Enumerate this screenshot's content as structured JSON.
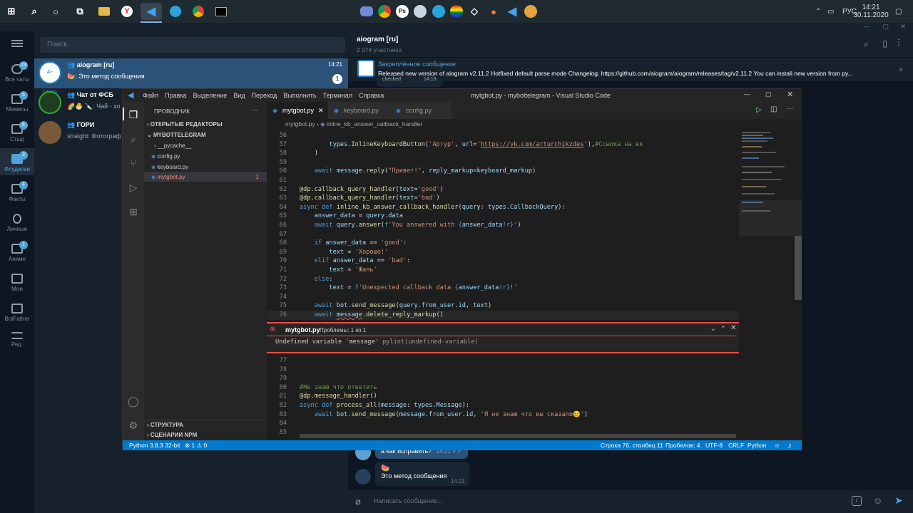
{
  "taskbar": {
    "lang": "РУС",
    "time": "14:21",
    "date": "30.11.2020"
  },
  "folders": [
    {
      "label": "Все чаты",
      "badge": "23"
    },
    {
      "label": "Мемесы",
      "badge": "5"
    },
    {
      "label": "Стыд",
      "badge": "6"
    },
    {
      "label": "Флудилки",
      "badge": "3"
    },
    {
      "label": "Факты",
      "badge": "4"
    },
    {
      "label": "Личные",
      "badge": ""
    },
    {
      "label": "Аниме",
      "badge": "1"
    },
    {
      "label": "Мои",
      "badge": ""
    },
    {
      "label": "BotFather",
      "badge": ""
    },
    {
      "label": "Ред.",
      "badge": ""
    }
  ],
  "chatlist": {
    "search_placeholder": "Поиск",
    "chats": [
      {
        "name": "aiogram [ru]",
        "preview": "🍉: Это метод сообщения",
        "time": "14:21",
        "unread": "1"
      },
      {
        "name": "Чат от ФСБ",
        "preview": "🌈🐣 🔪: Чай - хо",
        "time": "",
        "unread": ""
      },
      {
        "name": "ГОРИ",
        "preview": "straight: Фотограф",
        "time": "",
        "unread": ""
      }
    ]
  },
  "chat": {
    "title": "aiogram [ru]",
    "members": "2 074 участника",
    "pinned_label": "Закреплённое сообщение",
    "pinned_text": "Released new version of aiogram v2.11.2  Hotfixed default parse mode  Changelog: https://github.com/aiogram/aiogram/releases/tag/v2.11.2 You can install new version from py...",
    "msg_hidden_text": "checked",
    "msg_hidden_time": "14:16",
    "msg1_text": "а как исправить?",
    "msg1_time": "14:21",
    "msg2_sticker": "🍉",
    "msg2_text": "Это метод сообщения",
    "msg2_time": "14:21",
    "composer_placeholder": "Написать сообщение..."
  },
  "vscode": {
    "menu": [
      "Файл",
      "Правка",
      "Выделение",
      "Вид",
      "Переход",
      "Выполнить",
      "Терминал",
      "Справка"
    ],
    "title": "mytgbot.py - mybottelegram - Visual Studio Code",
    "explorer": "ПРОВОДНИК",
    "open_editors": "ОТКРЫТЫЕ РЕДАКТОРЫ",
    "folder": "MYBOTTELEGRAM",
    "files": [
      "__pycache__",
      "config.py",
      "keyboard.py",
      "mytgbot.py"
    ],
    "error_count": "1",
    "outline": "СТРУКТУРА",
    "npm": "СЦЕНАРИИ NPM",
    "tabs": [
      "mytgbot.py",
      "keyboard.py",
      "config.py"
    ],
    "breadcrumb": [
      "mytgbot.py",
      "inline_kb_answer_callback_handler"
    ],
    "peek_title": "mytgbot.py",
    "peek_sub": "Проблемы: 1 из 1",
    "peek_msg": "Undefined variable 'message'",
    "peek_code": "pylint(undefined-variable)",
    "status": {
      "python": "Python 3.8.3 32-bit",
      "errors": "⊗ 1 ⚠ 0",
      "pos": "Строка 76, столбец 11",
      "spaces": "Пробелов: 4",
      "enc": "UTF-8",
      "eol": "CRLF",
      "lang": "Python"
    }
  }
}
